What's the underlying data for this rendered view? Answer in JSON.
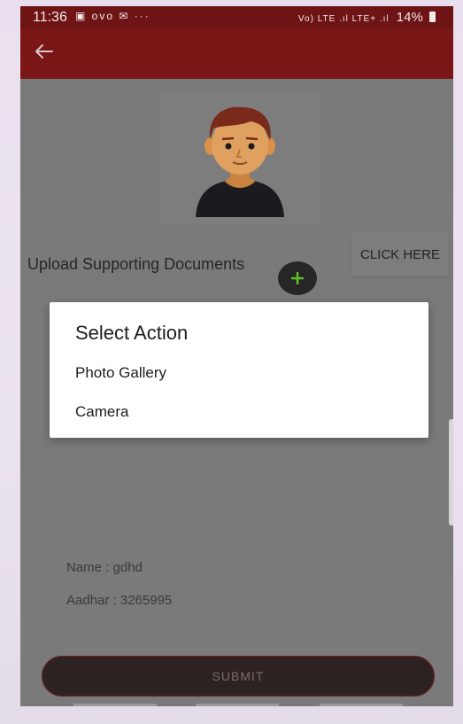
{
  "status_bar": {
    "time": "11:36",
    "left_icons": "▣ ovo ✉ ···",
    "signal_text": "Vo) LTE .ıl LTE+ .ıl",
    "battery": "14%"
  },
  "colors": {
    "app_bar": "#7a1616",
    "status_bar": "#6e1414",
    "scrim": "#7a7a7a",
    "submit_bg": "#2d2222",
    "add_icon": "#5fbf2a"
  },
  "icons": {
    "back": "arrow-left-icon",
    "add_photo": "plus-icon",
    "avatar": "person-avatar-icon"
  },
  "upload": {
    "label": "Upload Supporting Documents",
    "button_label": "CLICK HERE"
  },
  "dialog": {
    "title": "Select Action",
    "options": [
      "Photo Gallery",
      "Camera"
    ]
  },
  "info": {
    "name": "Name : gdhd",
    "aadhar": "Aadhar : 3265995"
  },
  "submit": {
    "label": "SUBMIT"
  }
}
